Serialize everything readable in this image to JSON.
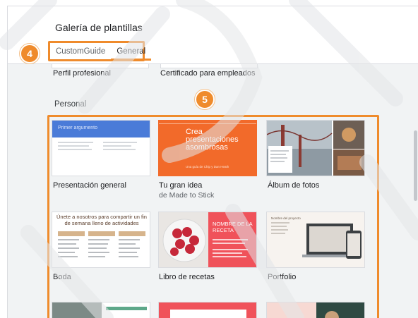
{
  "header": {
    "title": "Galería de plantillas",
    "tabs": [
      {
        "label": "CustomGuide",
        "active": false
      },
      {
        "label": "General",
        "active": true
      }
    ]
  },
  "badges": {
    "tabs": "4",
    "section": "5"
  },
  "previous_row": {
    "items": [
      {
        "label": "Perfil profesional"
      },
      {
        "label": "Certificado para empleados"
      }
    ]
  },
  "section": {
    "title": "Personal",
    "templates": [
      {
        "label": "Presentación general",
        "sub": "",
        "thumb_text": "Primer argumento"
      },
      {
        "label": "Tu gran idea",
        "sub": "de Made to Stick",
        "thumb_text": "Crea presentaciones asombrosas",
        "thumb_caption": "Una guía de Chip y Dan Heath"
      },
      {
        "label": "Álbum de fotos",
        "sub": ""
      },
      {
        "label": "Boda",
        "sub": "",
        "thumb_text": "Únete a nosotros para compartir un fin de semana lleno de actividades"
      },
      {
        "label": "Libro de recetas",
        "sub": "",
        "thumb_text": "NOMBRE DE LA RECETA"
      },
      {
        "label": "Portfolio",
        "sub": "",
        "thumb_text": "Nombre del proyecto"
      }
    ]
  },
  "colors": {
    "accent": "#ef8b2c",
    "blue": "#4a7bd8",
    "orange_card": "#f26a2a",
    "coral": "#f0525a"
  }
}
